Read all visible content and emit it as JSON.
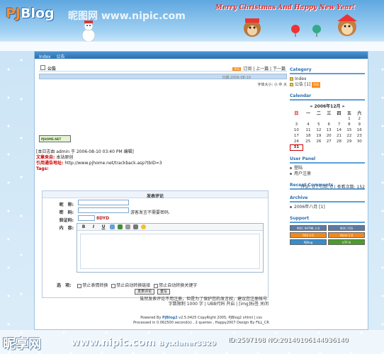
{
  "watermark": {
    "top_site": "昵图网",
    "top_url": "www.nipic.com",
    "bottom_site": "昵享网",
    "bottom_url": "www.nipic.com",
    "bottom_user": "By:xianer3329",
    "bottom_id": "ID:2597108 NO:20140106144936140"
  },
  "header": {
    "logo_prefix": "PJ",
    "logo_suffix": "Blog",
    "xmas_text": "Merry Christmas And Happy New Year!"
  },
  "nav": {
    "items": [
      "Index",
      "公告"
    ]
  },
  "post": {
    "title": "公告",
    "tools": [
      "订阅",
      "上一篇",
      "下一篇"
    ],
    "date_bar": "日期:2006-08-10",
    "font_size": "字体大小: 小 中 大",
    "banner_text": "PJHOME.NET",
    "meta_line1": "[本日志由 admin 于 2006-08-10 03:40 PM 编辑]",
    "meta_source_label": "文章来自:",
    "meta_source": "本站原创",
    "meta_trackback_label": "引用通告地址:",
    "meta_trackback": "http://www.pjhome.net/trackback.asp?tbID=3",
    "meta_tags_label": "Tags:",
    "stats": "评论: 0 | 引用: 0 | 查看次数: 152"
  },
  "comment_form": {
    "title": "发表评论",
    "labels": {
      "nickname": "昵　称:",
      "password": "密　码:",
      "verify": "验证码:",
      "content": "内　容:",
      "options": "选　项:"
    },
    "password_note": "游客发言不需要密码.",
    "verify_code": "8DYD",
    "toolbar": [
      "B",
      "I",
      "U"
    ],
    "options": [
      "禁止表情转换",
      "禁止自动转换链接",
      "禁止自动转换关键字"
    ],
    "submit_label": "发表评论",
    "reset_label": "重写",
    "footer_note1": "虽然发表评论不用注册，但是为了保护您的发言权，建议您注册帐号.",
    "footer_note2": "字数限制 1000 字 | UBB代码 开启 | [img]标签 关闭"
  },
  "sidebar": {
    "category_title": "Category",
    "category_items": [
      "Index",
      "公告 [1]"
    ],
    "calendar_title": "Calendar",
    "calendar_month": "2006年12月",
    "calendar_weekdays": [
      "日",
      "一",
      "二",
      "三",
      "四",
      "五",
      "六"
    ],
    "calendar_rows": [
      [
        "",
        "",
        "",
        "",
        "",
        "1",
        "2"
      ],
      [
        "3",
        "4",
        "5",
        "6",
        "7",
        "8",
        "9"
      ],
      [
        "10",
        "11",
        "12",
        "13",
        "14",
        "15",
        "16"
      ],
      [
        "17",
        "18",
        "19",
        "20",
        "21",
        "22",
        "23"
      ],
      [
        "24",
        "25",
        "26",
        "27",
        "28",
        "29",
        "30"
      ],
      [
        "31",
        "",
        "",
        "",
        "",
        "",
        ""
      ]
    ],
    "user_panel_title": "User Panel",
    "user_panel_items": [
      "登陆",
      "用户注册"
    ],
    "recent_comments_title": "Recent Comments",
    "archive_title": "Archive",
    "archive_items": [
      "2006年八月 [1]"
    ],
    "support_title": "Support",
    "support_badges": [
      "W3C XHTML 1.0",
      "W3C CSS",
      "RSS 2.0",
      "Atom 1.0",
      "PJBlog",
      "UTF-8"
    ]
  },
  "footer": {
    "line1_prefix": "Powered By",
    "line1_brand": "PJBlog2",
    "line1_rest": "v2.5.0425 CopyRight 2005, PJBlog2 xhtml | css",
    "line2": "Processed in 0.062500 second(s) , 2 queries , Happy2007 Design By FiLL_CR"
  }
}
